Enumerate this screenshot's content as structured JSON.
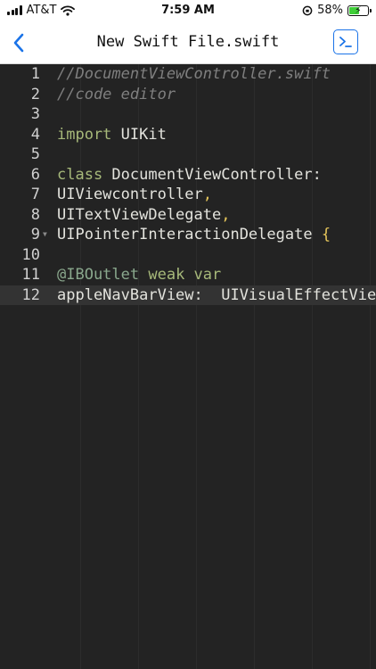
{
  "status_bar": {
    "carrier": "AT&T",
    "time": "7:59 AM",
    "battery_percent": "58%",
    "battery_level": 0.58
  },
  "nav": {
    "title": "New Swift File.swift"
  },
  "colors": {
    "editor_background": "#232323",
    "current_line": "#333333",
    "accent_blue": "#1a73e8",
    "keyword": "#a7b97a",
    "comment": "#7f7f7f"
  },
  "editor": {
    "lines": [
      {
        "number": "1",
        "tokens": [
          {
            "kind": "comment",
            "text": "//DocumentViewController.swift"
          }
        ]
      },
      {
        "number": "2",
        "tokens": [
          {
            "kind": "comment",
            "text": "//code editor"
          }
        ]
      },
      {
        "number": "3",
        "tokens": []
      },
      {
        "number": "4",
        "tokens": [
          {
            "kind": "keyword",
            "text": "import"
          },
          {
            "kind": "plain",
            "text": " UIKit"
          }
        ]
      },
      {
        "number": "5",
        "tokens": []
      },
      {
        "number": "6",
        "tokens": [
          {
            "kind": "keyword",
            "text": "class"
          },
          {
            "kind": "plain",
            "text": " DocumentViewController:"
          }
        ]
      },
      {
        "number": "7",
        "tokens": [
          {
            "kind": "plain",
            "text": "UIViewcontroller"
          },
          {
            "kind": "brace",
            "text": ","
          }
        ]
      },
      {
        "number": "8",
        "tokens": [
          {
            "kind": "plain",
            "text": "UITextViewDelegate"
          },
          {
            "kind": "brace",
            "text": ","
          }
        ]
      },
      {
        "number": "9",
        "fold": true,
        "tokens": [
          {
            "kind": "plain",
            "text": "UIPointerInteractionDelegate "
          },
          {
            "kind": "brace",
            "text": "{"
          }
        ]
      },
      {
        "number": "10",
        "tokens": []
      },
      {
        "number": "11",
        "tokens": [
          {
            "kind": "attr",
            "text": "@IBOutlet"
          },
          {
            "kind": "keyword",
            "text": " weak var"
          }
        ]
      },
      {
        "number": "12",
        "current": true,
        "tokens": [
          {
            "kind": "plain",
            "text": "appleNavBarView:  UIVisualEffectView!"
          }
        ]
      }
    ]
  }
}
